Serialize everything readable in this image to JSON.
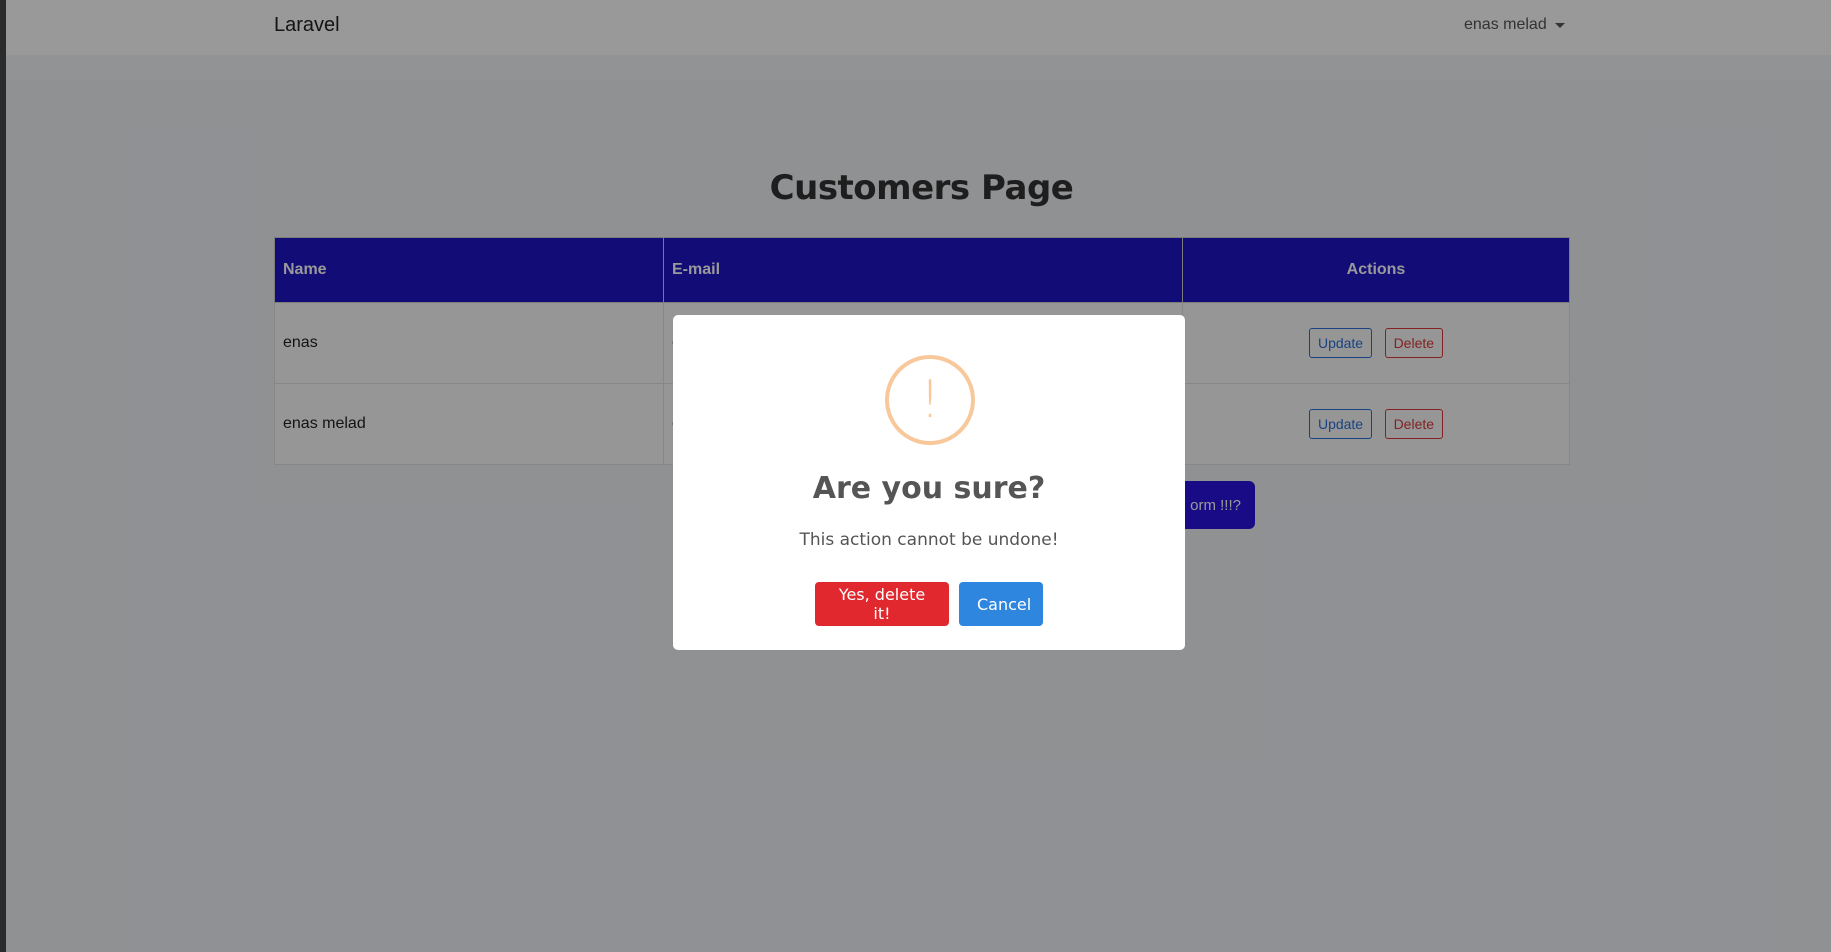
{
  "navbar": {
    "brand": "Laravel",
    "user_name": "enas melad"
  },
  "page": {
    "title": "Customers Page"
  },
  "table": {
    "headers": [
      "Name",
      "E-mail",
      "Actions"
    ],
    "rows": [
      {
        "name": "enas",
        "email": "e",
        "update": "Update",
        "delete": "Delete"
      },
      {
        "name": "enas melad",
        "email": "e",
        "update": "Update",
        "delete": "Delete"
      }
    ]
  },
  "form_button": {
    "label": "orm !!!?"
  },
  "modal": {
    "icon": "!",
    "title": "Are you sure?",
    "text": "This action cannot be undone!",
    "confirm": "Yes, delete it!",
    "cancel": "Cancel"
  },
  "colors": {
    "header_bg": "#1f14c6",
    "warning": "#f8c89a",
    "confirm": "#e0282e",
    "cancel": "#2e86de"
  }
}
